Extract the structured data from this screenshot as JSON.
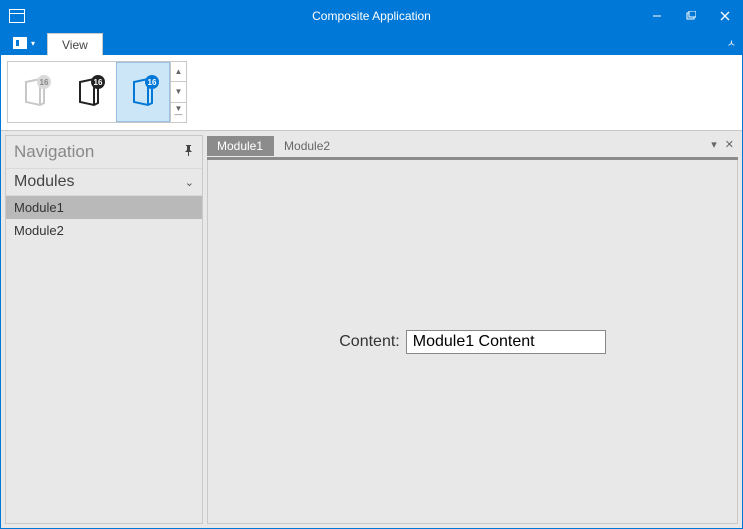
{
  "window": {
    "title": "Composite Application"
  },
  "ribbon": {
    "tab_label": "View",
    "gallery_badge": "16"
  },
  "navigation": {
    "title": "Navigation",
    "section_label": "Modules",
    "items": [
      "Module1",
      "Module2"
    ],
    "selected_index": 0
  },
  "documents": {
    "tabs": [
      "Module1",
      "Module2"
    ],
    "active_index": 0,
    "content_label": "Content:",
    "content_value": "Module1 Content"
  }
}
